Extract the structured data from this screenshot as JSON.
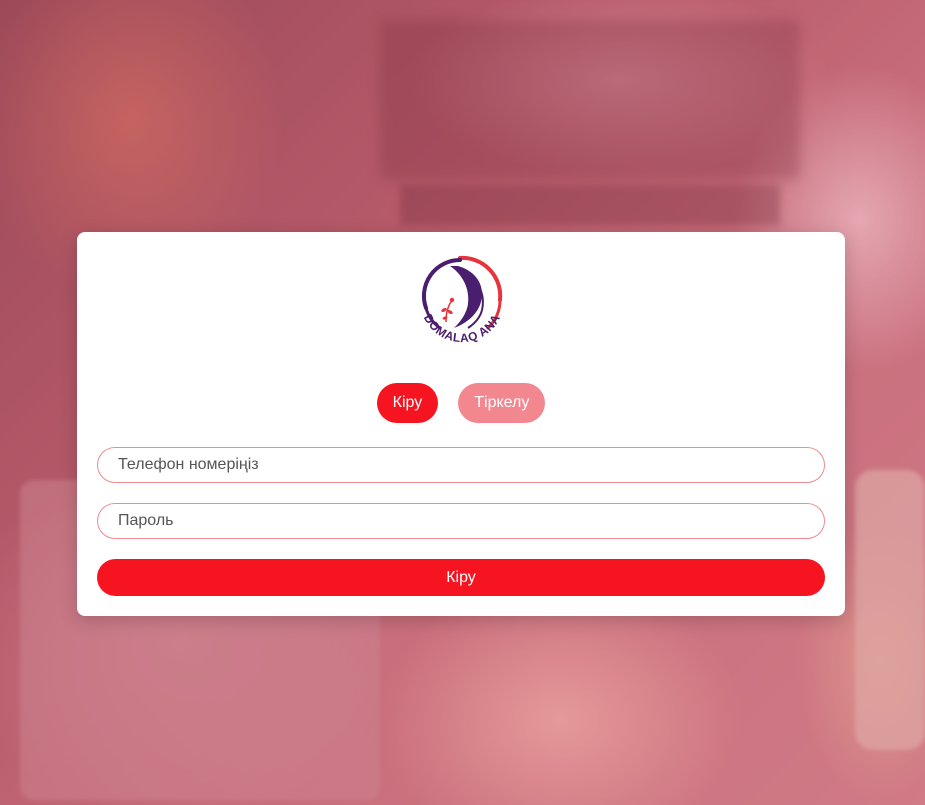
{
  "logo": {
    "text": "DOMALAQ ANA",
    "colors": {
      "purple": "#4a1d6e",
      "red": "#e8323c"
    }
  },
  "tabs": [
    {
      "label": "Кіру",
      "active": true
    },
    {
      "label": "Тіркелу",
      "active": false
    }
  ],
  "form": {
    "phone_placeholder": "Телефон номеріңіз",
    "phone_value": "",
    "password_placeholder": "Пароль",
    "password_value": "",
    "submit_label": "Кіру"
  },
  "colors": {
    "accent": "#f5141f",
    "accent_light": "#f3878f",
    "field_border": "#ee8c92"
  }
}
